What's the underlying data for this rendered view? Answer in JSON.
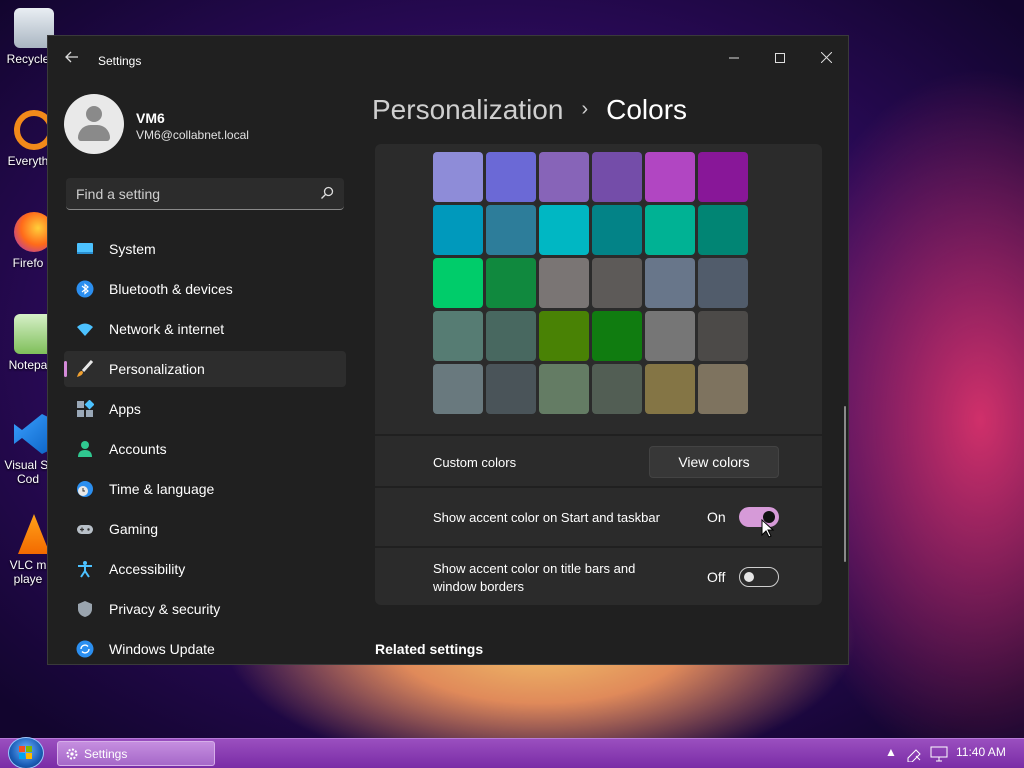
{
  "desktop": {
    "icons": [
      {
        "label": "Recycle",
        "icon": "recycle-bin-icon"
      },
      {
        "label": "Everyth",
        "icon": "everything-icon"
      },
      {
        "label": "Firefo",
        "icon": "firefox-icon"
      },
      {
        "label": "Notepa",
        "icon": "notepad-icon"
      },
      {
        "label": "Visual St",
        "label2": "Cod",
        "icon": "vscode-icon"
      },
      {
        "label": "VLC m",
        "label2": "playe",
        "icon": "vlc-icon"
      }
    ]
  },
  "window": {
    "title": "Settings",
    "back_icon": "back-arrow-icon",
    "controls": {
      "minimize": "minimize-icon",
      "maximize": "maximize-icon",
      "close": "close-icon"
    }
  },
  "profile": {
    "name": "VM6",
    "email": "VM6@collabnet.local"
  },
  "search": {
    "placeholder": "Find a setting"
  },
  "sidebar": {
    "items": [
      {
        "label": "System",
        "icon": "system-icon"
      },
      {
        "label": "Bluetooth & devices",
        "icon": "bluetooth-icon"
      },
      {
        "label": "Network & internet",
        "icon": "wifi-icon"
      },
      {
        "label": "Personalization",
        "icon": "brush-icon",
        "active": true
      },
      {
        "label": "Apps",
        "icon": "apps-icon"
      },
      {
        "label": "Accounts",
        "icon": "accounts-icon"
      },
      {
        "label": "Time & language",
        "icon": "clock-globe-icon"
      },
      {
        "label": "Gaming",
        "icon": "gamepad-icon"
      },
      {
        "label": "Accessibility",
        "icon": "accessibility-icon"
      },
      {
        "label": "Privacy & security",
        "icon": "shield-icon"
      },
      {
        "label": "Windows Update",
        "icon": "update-icon"
      }
    ]
  },
  "breadcrumb": {
    "parent": "Personalization",
    "separator": "›",
    "current": "Colors"
  },
  "accent_colors": [
    [
      "#e3008c",
      "#bf0077",
      "#c239b3",
      "#9a0089",
      "#0078d4",
      "#0063b1"
    ],
    [
      "#8e8cd8",
      "#6b69d6",
      "#8764b8",
      "#744da9",
      "#b146c2",
      "#881798"
    ],
    [
      "#0099bc",
      "#2d7d9a",
      "#00b7c3",
      "#038387",
      "#00b294",
      "#018574"
    ],
    [
      "#00cc6a",
      "#10893e",
      "#7a7574",
      "#5d5a58",
      "#68768a",
      "#515c6b"
    ],
    [
      "#567c73",
      "#486860",
      "#498205",
      "#107c10",
      "#767676",
      "#4c4a48"
    ],
    [
      "#69797e",
      "#4a5459",
      "#647c64",
      "#525e54",
      "#847545",
      "#7e735f"
    ]
  ],
  "custom_colors": {
    "label": "Custom colors",
    "button": "View colors"
  },
  "accent_start_taskbar": {
    "label": "Show accent color on Start and taskbar",
    "state": "On"
  },
  "accent_title_bars": {
    "label_line1": "Show accent color on title bars and",
    "label_line2": "window borders",
    "state": "Off"
  },
  "related_settings": "Related settings",
  "taskbar": {
    "start_icon": "windows-start-icon",
    "task_label": "Settings",
    "time": "11:40 AM"
  }
}
